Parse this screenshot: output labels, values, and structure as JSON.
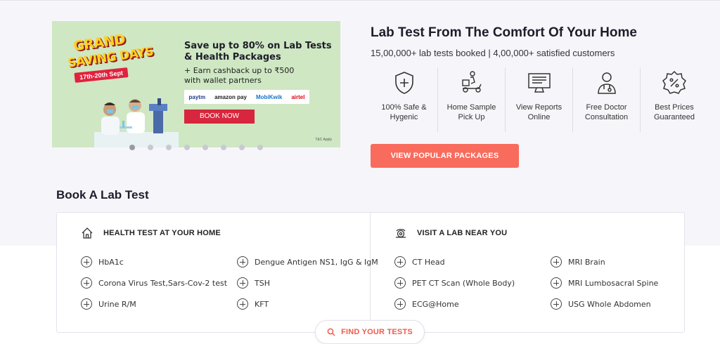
{
  "banner": {
    "badge_line1": "GRAND",
    "badge_line2": "SAVING DAYS",
    "badge_dates": "17th-20th Sept",
    "headline_1": "Save up to 80% on Lab Tests",
    "headline_2": "& Health Packages",
    "sub_1": "+ Earn cashback up to ₹500",
    "sub_2": "with wallet partners",
    "partners": [
      "paytm",
      "amazon pay",
      "MobiKwik",
      "airtel"
    ],
    "book_label": "BOOK NOW",
    "tnc": "T&C Apply",
    "slides_count": 8,
    "active_slide": 0
  },
  "info": {
    "title": "Lab Test From The Comfort Of Your Home",
    "stats": "15,00,000+ lab tests booked | 4,00,000+ satisfied customers",
    "features": [
      {
        "icon": "shield-plus-icon",
        "label": "100% Safe & Hygenic"
      },
      {
        "icon": "delivery-scooter-icon",
        "label": "Home Sample Pick Up"
      },
      {
        "icon": "monitor-report-icon",
        "label": "View Reports Online"
      },
      {
        "icon": "doctor-icon",
        "label": "Free Doctor Consultation"
      },
      {
        "icon": "percent-badge-icon",
        "label": "Best Prices Guaranteed"
      }
    ],
    "cta": "VIEW POPULAR PACKAGES"
  },
  "book_section": {
    "title": "Book A Lab Test",
    "home": {
      "heading": "HEALTH TEST AT YOUR HOME",
      "tests": [
        "HbA1c",
        "Dengue Antigen NS1, IgG & IgM",
        "Corona Virus Test,Sars-Cov-2 test",
        "TSH",
        "Urine R/M",
        "KFT"
      ]
    },
    "lab": {
      "heading": "VISIT A LAB NEAR YOU",
      "tests": [
        "CT Head",
        "MRI Brain",
        "PET CT Scan (Whole Body)",
        "MRI Lumbosacral Spine",
        "ECG@Home",
        "USG Whole Abdomen"
      ]
    },
    "find_label": "FIND YOUR TESTS"
  },
  "colors": {
    "accent": "#f86b5d",
    "banner_bg": "#cfe7c3",
    "book_now": "#d7263d",
    "page_bg": "#f6f6fa"
  }
}
